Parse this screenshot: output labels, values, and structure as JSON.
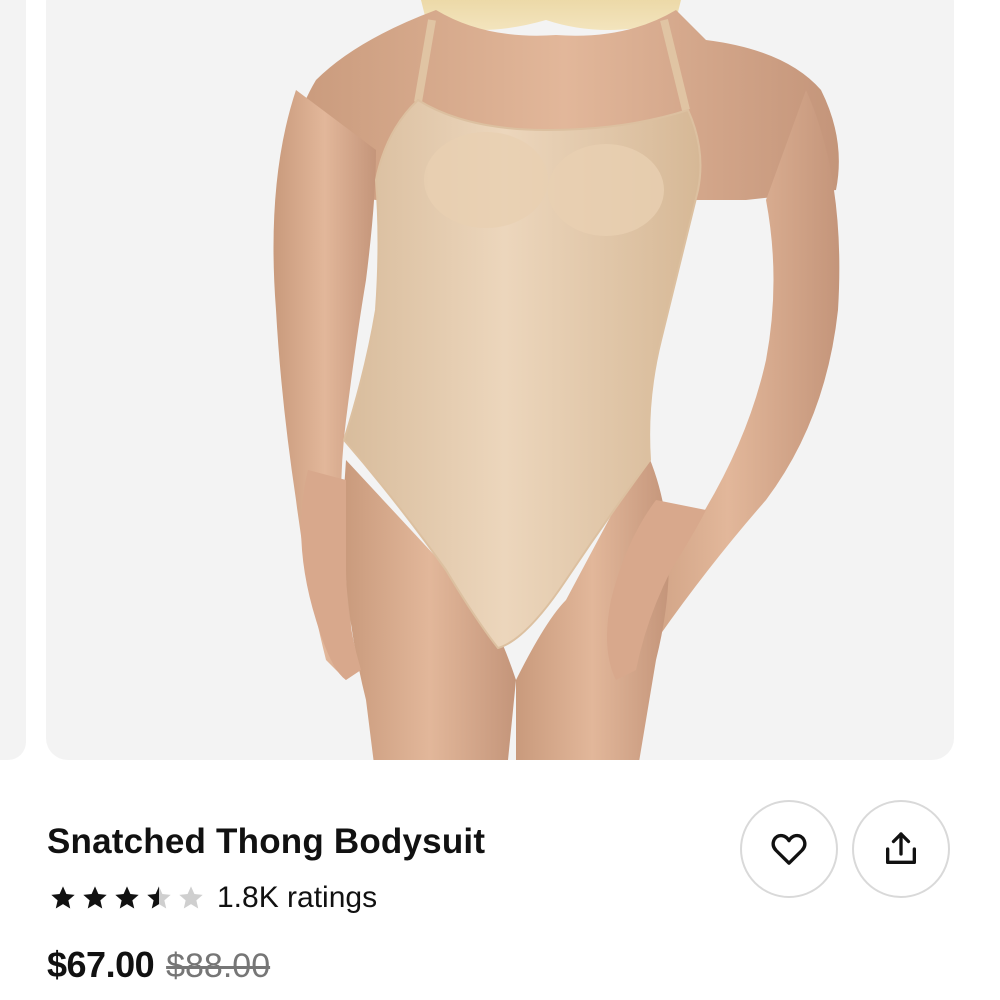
{
  "product": {
    "title": "Snatched Thong Bodysuit",
    "rating": 3.5,
    "rating_max": 5,
    "ratings_count_label": "1.8K ratings",
    "price_current": "$67.00",
    "price_original": "$88.00"
  },
  "actions": {
    "favorite_icon": "heart-outline-icon",
    "share_icon": "share-upload-icon"
  },
  "icons": {
    "star_filled": "star-filled-icon",
    "star_half": "star-half-icon",
    "star_empty": "star-empty-icon"
  },
  "colors": {
    "text_primary": "#111111",
    "text_strike": "#767676",
    "star_filled": "#111111",
    "star_empty": "#cfcfcf",
    "card_background": "#f3f3f3",
    "button_border": "#d9d9d9",
    "garment_nude": "#e6cdb0"
  }
}
